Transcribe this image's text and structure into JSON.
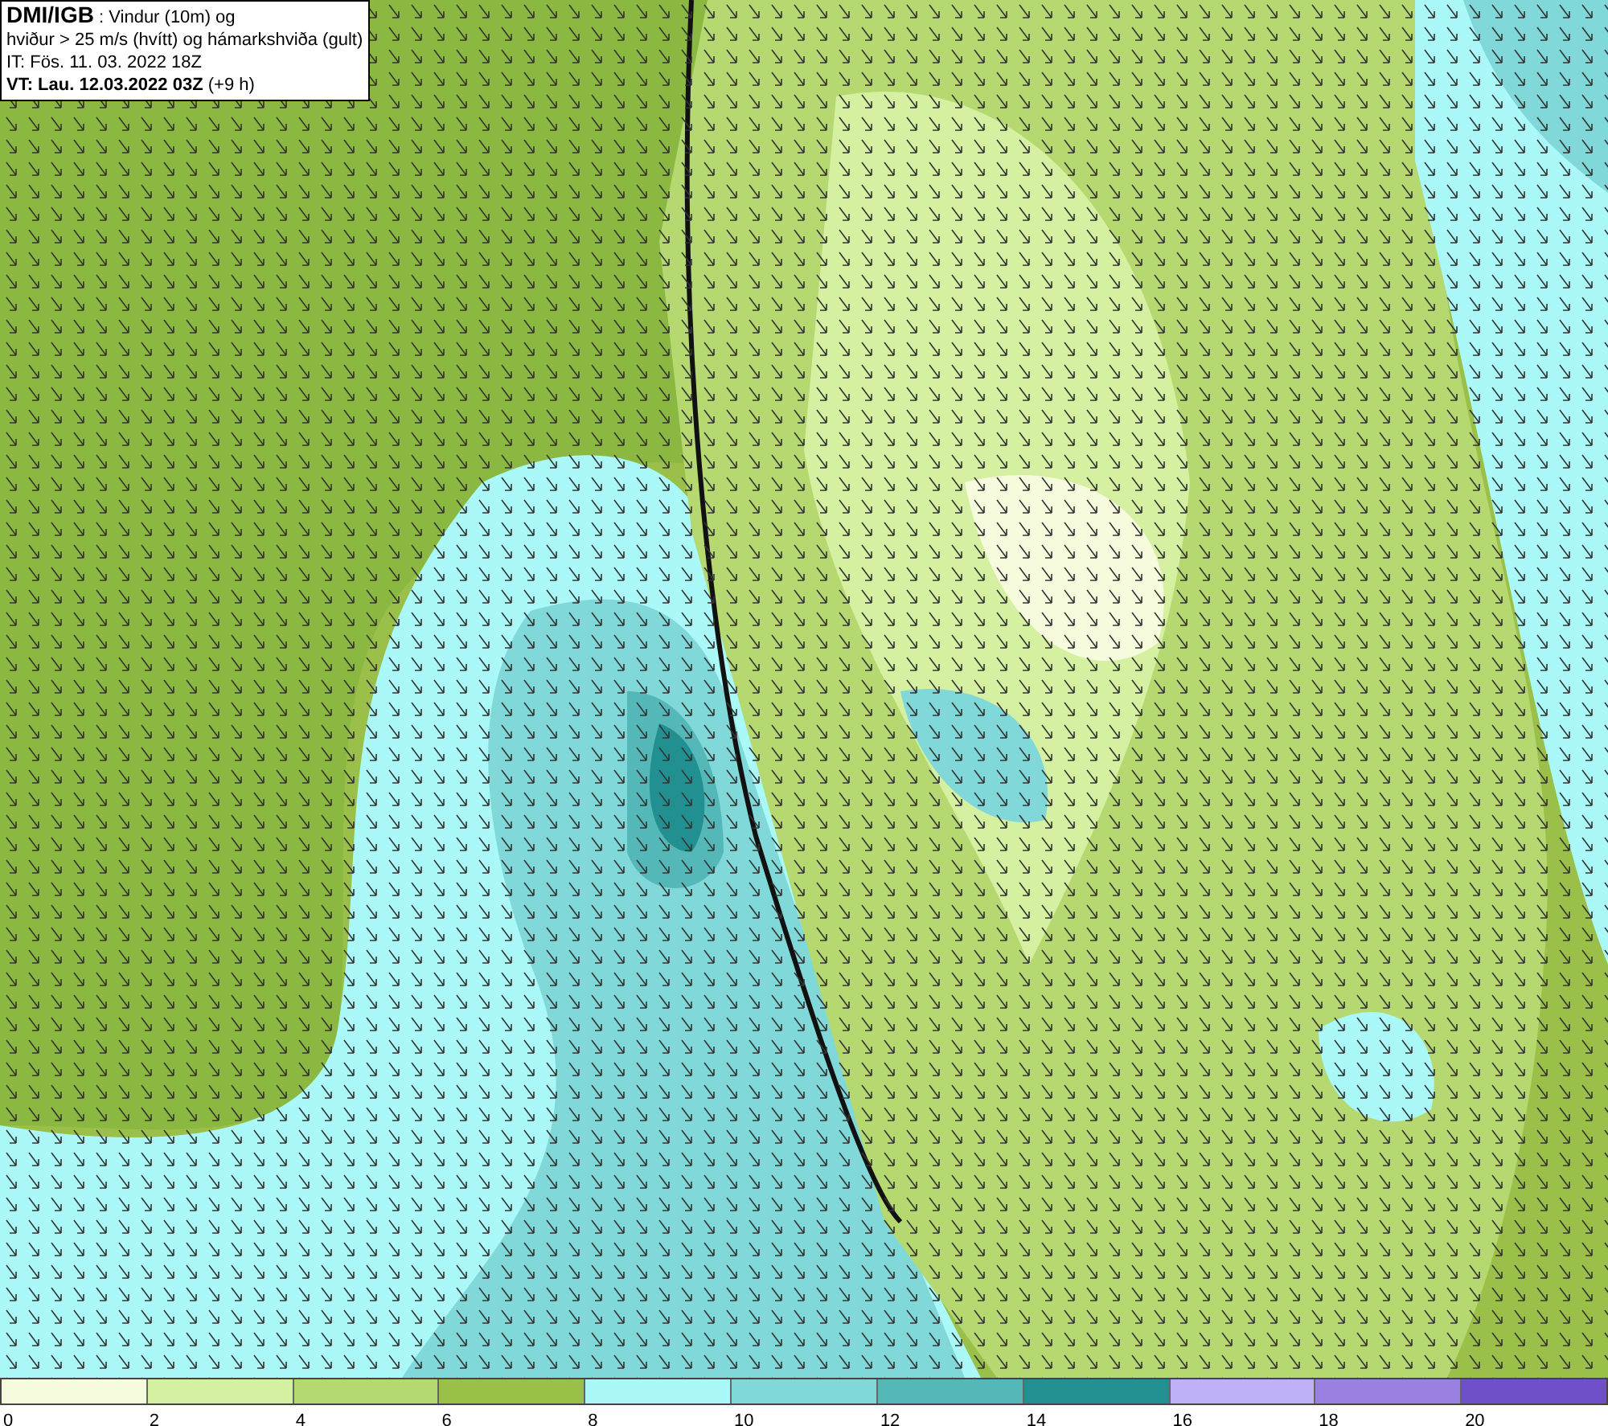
{
  "info_box": {
    "lines": [
      "**DMI/IGB** : Vindur (10m) og",
      "hviður > 25 m/s (hvítt) og hámarkshviða (gult)",
      "IT: Fös. 11. 03. 2022 18Z",
      "**VT: Lau. 12.03.2022 03Z** (+9 h)"
    ]
  },
  "legend": {
    "segments": [
      {
        "label": "0",
        "color": "#f5fbdc"
      },
      {
        "label": "2",
        "color": "#d5f0a0"
      },
      {
        "label": "4",
        "color": "#b5d870"
      },
      {
        "label": "6",
        "color": "#9bc04a"
      },
      {
        "label": "8",
        "color": "#aaf8f8"
      },
      {
        "label": "10",
        "color": "#80d8d8"
      },
      {
        "label": "12",
        "color": "#55b8b8"
      },
      {
        "label": "14",
        "color": "#229090"
      },
      {
        "label": "16",
        "color": "#c0b0f8"
      },
      {
        "label": "18",
        "color": "#9a80e0"
      },
      {
        "label": "20",
        "color": "#7050c8"
      }
    ]
  }
}
